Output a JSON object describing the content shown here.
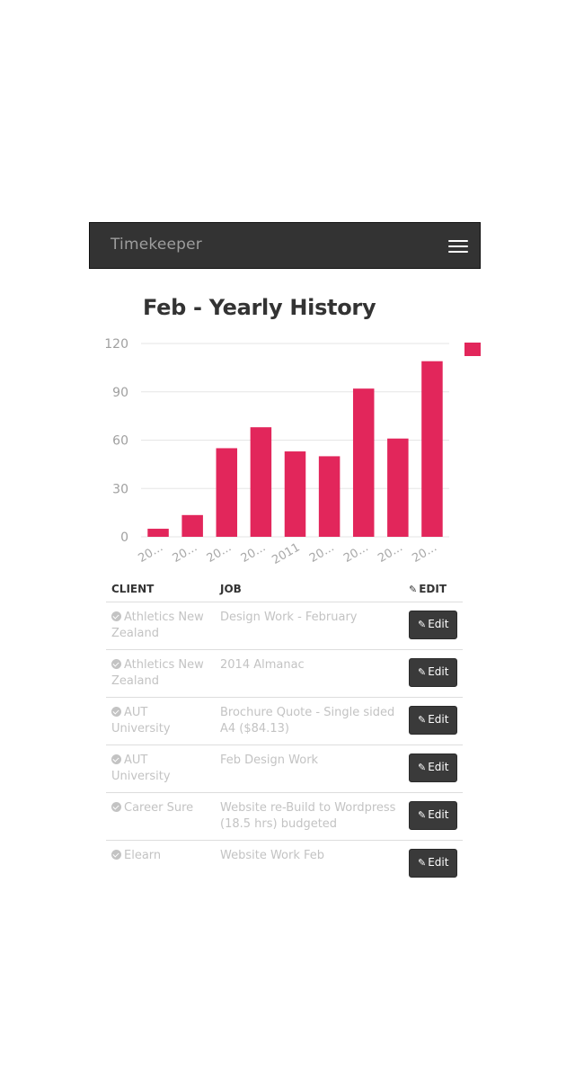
{
  "navbar": {
    "brand": "Timekeeper",
    "menu_icon": "hamburger-menu-icon"
  },
  "chart_data": {
    "type": "bar",
    "title": "Feb - Yearly History",
    "categories": [
      "20...",
      "20...",
      "20...",
      "20...",
      "2011",
      "20...",
      "20...",
      "20...",
      "20..."
    ],
    "values": [
      5,
      13.5,
      55,
      68,
      53,
      50,
      92,
      61,
      109
    ],
    "ylim": [
      0,
      120
    ],
    "yticks": [
      0,
      30,
      60,
      90,
      120
    ],
    "xlabel": "",
    "ylabel": "",
    "bar_color": "#e2265b",
    "grid": true,
    "legend_placement": "top-right"
  },
  "table": {
    "headers": {
      "client": "CLIENT",
      "job": "JOB",
      "edit": "EDIT"
    },
    "edit_label": "Edit",
    "rows": [
      {
        "client": "Athletics New Zealand",
        "job": "Design Work - February"
      },
      {
        "client": "Athletics New Zealand",
        "job": "2014 Almanac"
      },
      {
        "client": "AUT University",
        "job": "Brochure Quote - Single sided A4 ($84.13)"
      },
      {
        "client": "AUT University",
        "job": "Feb Design Work"
      },
      {
        "client": "Career Sure",
        "job": "Website re-Build to Wordpress (18.5 hrs) budgeted"
      },
      {
        "client": "Elearn",
        "job": "Website Work Feb"
      }
    ]
  },
  "colors": {
    "navbar": "#333333",
    "accent": "#e2265b",
    "muted_text": "#c3c3c3"
  }
}
